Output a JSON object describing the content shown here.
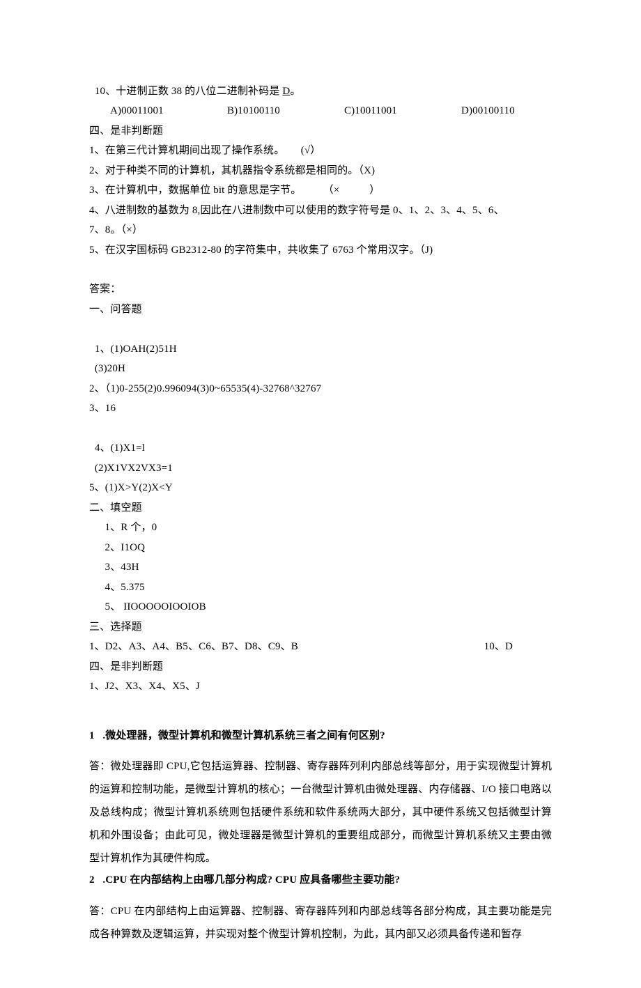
{
  "q10": {
    "text_before": "10、十进制正数 38 的八位二进制补码是 ",
    "underlined": "D",
    "text_after": "。",
    "opt_a": "A)00011001",
    "opt_b": "B)10100110",
    "opt_c": "C)10011001",
    "opt_d": "D)00100110"
  },
  "sec4_title": "四、是非判断题",
  "tf": {
    "i1": "1、在第三代计算机期间出现了操作系统。      (√）",
    "i2": "2、对于种类不同的计算机，其机器指令系统都是相同的。（X)",
    "i3": "3、在计算机中，数据单位 bit 的意思是字节。        （×           ）",
    "i4": "4、八进制数的基数为 8,因此在八进制数中可以使用的数字符号是 0、1、2、3、4、5、6、",
    "i4b": "7、8。（×）",
    "i5": "5、在汉字国标码 GB2312-80 的字符集中，共收集了 6763 个常用汉字。（J)"
  },
  "answers_title": "答案：",
  "sec1a_title": "一、问答题",
  "a1": {
    "l1a": "1、(1)OAH(2)51H",
    "l1b": "(3)20H",
    "l2": "2、（1)0-255(2)0.996094(3)0~65535(4)-32768^32767",
    "l3": "3、16",
    "l4a": "4、(1)X1=l",
    "l4b": "(2)X1VX2VX3=1",
    "l5": "5、(1)X>Y(2)X<Y"
  },
  "sec2a_title": "二、填空题",
  "a2": {
    "l1": "1、R 个，0",
    "l2": "2、I1OQ",
    "l3": "3、43H",
    "l4": "4、5.375",
    "l5": "5、 IIOOOOOIOOIOB"
  },
  "sec3a_title": "三、选择题",
  "a3": {
    "left": "1、D2、A3、A4、B5、C6、B7、D8、C9、B",
    "right": "10、D"
  },
  "sec4a_title": "四、是非判断题",
  "a4": "1、J2、X3、X4、X5、J",
  "essay": {
    "q1_title": "1   .微处理器，微型计算机和微型计算机系统三者之间有何区别?",
    "q1_p1": "答：微处理器即 CPU,它包括运算器、控制器、寄存器阵列利内部总线等部分，用于实现微型计算机的运算和控制功能，是微型计算机的核心；一台微型计算机由微处理器、内存储器、I/O 接口电路以及总线构成；微型计算机系统则包括硬件系统和软件系统两大部分，其中硬件系统又包括微型计算机和外围设备；由此可见，微处理器是微型计算机的重要组成部分，而微型计算机系统又主要由微型计算机作为其硬件构成。",
    "q2_title": "2   .CPU 在内部结构上由哪几部分构成? CPU 应具备哪些主要功能?",
    "q2_p1": "答：CPU 在内部结构上由运算器、控制器、寄存器阵列和内部总线等各部分构成，其主要功能是完成各种算数及逻辑运算，并实现对整个微型计算机控制，为此，其内部又必须具备传递和暂存"
  }
}
